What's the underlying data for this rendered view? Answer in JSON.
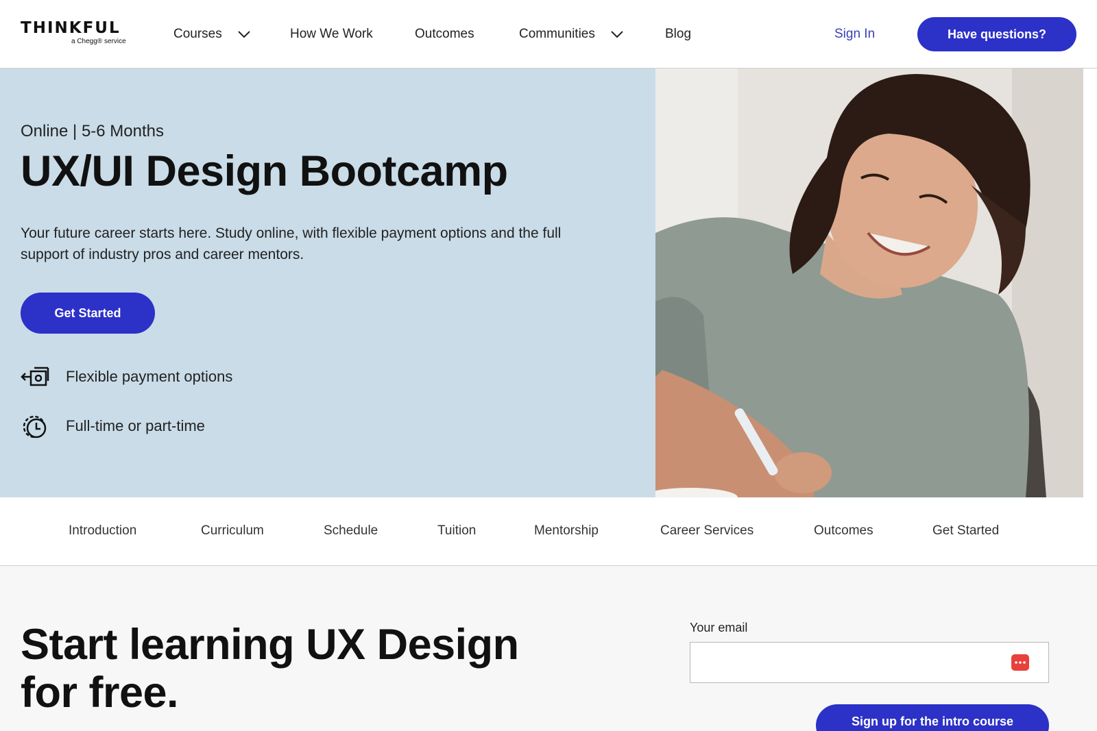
{
  "brand": {
    "name": "THINKFUL",
    "tagline": "a Chegg® service"
  },
  "header": {
    "nav": [
      {
        "label": "Courses",
        "has_dropdown": true
      },
      {
        "label": "How We Work",
        "has_dropdown": false
      },
      {
        "label": "Outcomes",
        "has_dropdown": false
      },
      {
        "label": "Communities",
        "has_dropdown": true
      },
      {
        "label": "Blog",
        "has_dropdown": false
      }
    ],
    "sign_in": "Sign In",
    "cta": "Have questions?"
  },
  "hero": {
    "meta_mode": "Online",
    "meta_sep": "|",
    "meta_duration": "5-6 Months",
    "title": "UX/UI Design Bootcamp",
    "description": "Your future career starts here. Study online, with flexible payment options and the full support of industry pros and career mentors.",
    "cta": "Get Started",
    "features": [
      {
        "icon": "payment-icon",
        "text": "Flexible payment options"
      },
      {
        "icon": "clock-icon",
        "text": "Full-time or part-time"
      }
    ],
    "photo": "woman-writing-photo"
  },
  "subnav": {
    "items": [
      "Introduction",
      "Curriculum",
      "Schedule",
      "Tuition",
      "Mentorship",
      "Career Services",
      "Outcomes",
      "Get Started"
    ]
  },
  "signup": {
    "title": "Start learning UX Design for free.",
    "email_label": "Your email",
    "email_value": "",
    "email_placeholder": "",
    "button": "Sign up for the intro course"
  },
  "colors": {
    "accent": "#2c31c7",
    "hero_bg": "#c9dce8",
    "signin": "#3a3fb8",
    "badge": "#e8413b"
  }
}
